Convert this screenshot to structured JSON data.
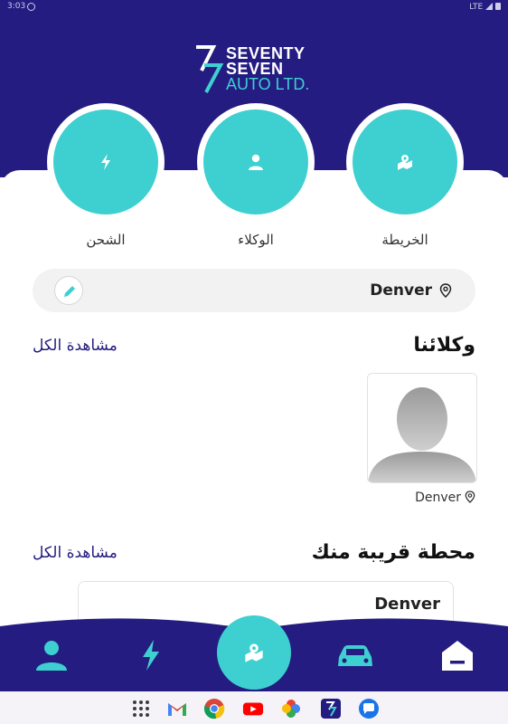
{
  "status_bar": {
    "time": "3:03",
    "network": "LTE"
  },
  "logo": {
    "line1": "SEVENTY",
    "line2": "SEVEN",
    "line3": "AUTO LTD."
  },
  "categories": [
    {
      "label": "الخريطة",
      "icon": "map-pin-icon"
    },
    {
      "label": "الوكلاء",
      "icon": "person-icon"
    },
    {
      "label": "الشحن",
      "icon": "bolt-icon"
    }
  ],
  "search": {
    "location": "Denver",
    "edit_icon": "pencil-icon"
  },
  "agents_section": {
    "title": "وكلائنا",
    "see_all": "مشاهدة الكل",
    "items": [
      {
        "location": "Denver",
        "image": "avatar-placeholder"
      }
    ]
  },
  "stations_section": {
    "title": "محطة قريبة منك",
    "see_all": "مشاهدة الكل",
    "items": [
      {
        "name": "Denver"
      }
    ]
  },
  "bottom_nav": {
    "items": [
      "profile-icon",
      "charging-icon",
      "map-icon",
      "car-icon",
      "home-icon"
    ],
    "active": "map-icon"
  },
  "colors": {
    "primary": "#241c80",
    "accent": "#3ecfd0"
  },
  "dock_apps": [
    "app-drawer-icon",
    "gmail-icon",
    "chrome-icon",
    "youtube-icon",
    "photos-icon",
    "seventy-seven-app-icon",
    "messages-icon"
  ]
}
